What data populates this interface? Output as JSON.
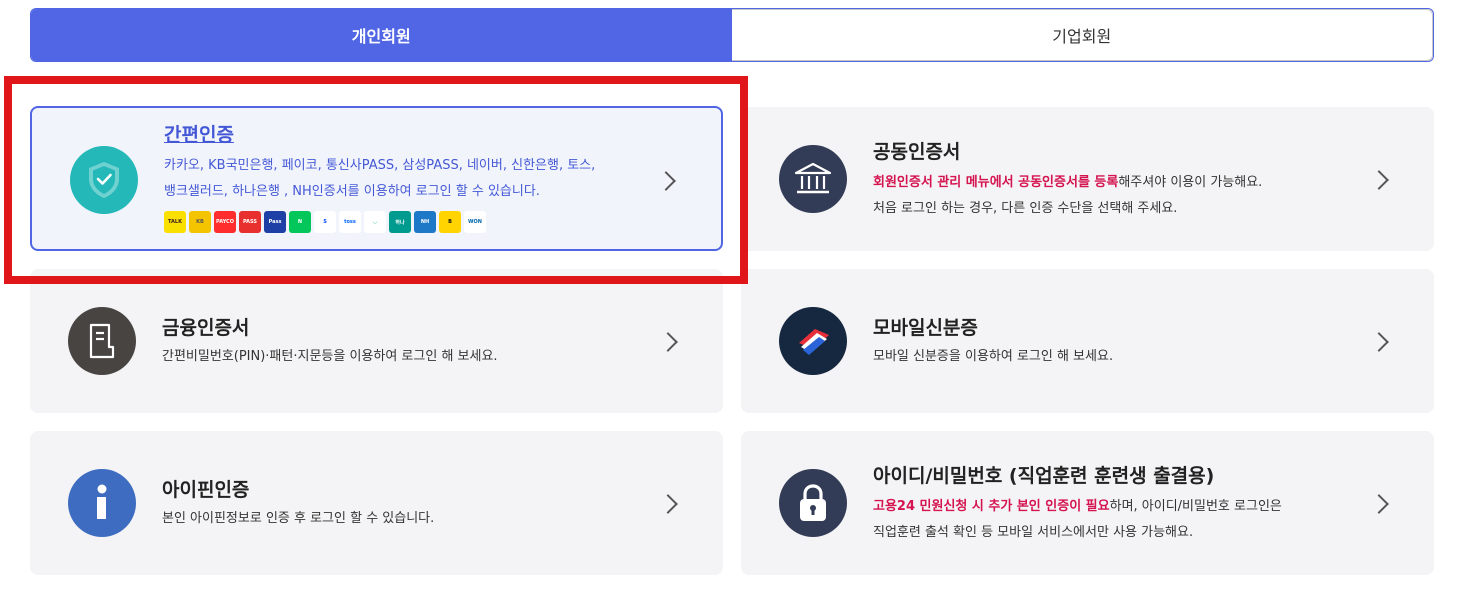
{
  "tabs": {
    "personal": "개인회원",
    "corporate": "기업회원"
  },
  "cards": {
    "simple_auth": {
      "title": "간편인증",
      "desc_line1": "카카오, KB국민은행, 페이코, 통신사PASS, 삼성PASS, 네이버, 신한은행, 토스,",
      "desc_line2": "뱅크샐러드, 하나은행 , NH인증서를 이용하여 로그인 할 수 있습니다."
    },
    "joint_cert": {
      "title": "공동인증서",
      "desc_hl": "회원인증서 관리 메뉴에서 공동인증서를 등록",
      "desc_line1_rest": "해주셔야 이용이 가능해요.",
      "desc_line2": "처음 로그인 하는 경우, 다른 인증 수단을 선택해 주세요."
    },
    "finance_cert": {
      "title": "금융인증서",
      "desc_line1": "간편비밀번호(PIN)·패턴·지문등을 이용하여 로그인 해 보세요."
    },
    "mobile_id": {
      "title": "모바일신분증",
      "desc_line1": "모바일 신분증을 이용하여 로그인 해 보세요."
    },
    "ipin": {
      "title": "아이핀인증",
      "desc_line1": "본인 아이핀정보로 인증 후 로그인 할 수 있습니다."
    },
    "id_pw": {
      "title": "아이디/비밀번호 (직업훈련 훈련생 출결용)",
      "desc_hl": "고용24 민원신청 시 추가 본인 인증이 필요",
      "desc_line1_rest": "하며, 아이디/비밀번호 로그인은",
      "desc_line2": "직업훈련 출석 확인 등 모바일 서비스에서만 사용 가능해요."
    }
  },
  "logos": [
    {
      "name": "kakao-talk-logo",
      "text": "TALK",
      "bg": "#f9e000",
      "fg": "#3a1d1d"
    },
    {
      "name": "kb-logo",
      "text": "KB",
      "bg": "#f5c400",
      "fg": "#555"
    },
    {
      "name": "payco-logo",
      "text": "PAYCO",
      "bg": "#ff2d2d",
      "fg": "#fff"
    },
    {
      "name": "pass-logo",
      "text": "PASS",
      "bg": "#e8302f",
      "fg": "#fff"
    },
    {
      "name": "samsung-pass-logo",
      "text": "Pass",
      "bg": "#1d3fa6",
      "fg": "#fff"
    },
    {
      "name": "naver-logo",
      "text": "N",
      "bg": "#03c75a",
      "fg": "#fff"
    },
    {
      "name": "shinhan-logo",
      "text": "S",
      "bg": "#ffffff",
      "fg": "#0046ff"
    },
    {
      "name": "toss-logo",
      "text": "toss",
      "bg": "#ffffff",
      "fg": "#0064ff"
    },
    {
      "name": "banksalad-logo",
      "text": "◡",
      "bg": "#ffffff",
      "fg": "#1ec27b"
    },
    {
      "name": "hana-logo",
      "text": "하나",
      "bg": "#009b8f",
      "fg": "#fff"
    },
    {
      "name": "nh-logo",
      "text": "NH",
      "bg": "#1e78c8",
      "fg": "#fff"
    },
    {
      "name": "b-logo",
      "text": "B",
      "bg": "#ffd400",
      "fg": "#111"
    },
    {
      "name": "woori-logo",
      "text": "WON",
      "bg": "#ffffff",
      "fg": "#0067ac"
    }
  ],
  "colors": {
    "accent": "#5166e4",
    "highlight_red": "#d4134f",
    "annotation_red": "#e0161b"
  }
}
